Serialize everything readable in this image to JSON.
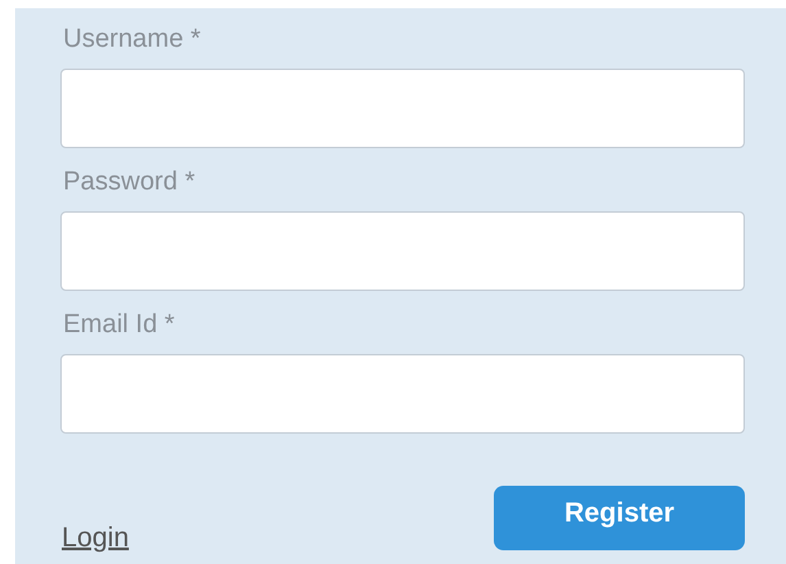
{
  "fields": [
    {
      "label": "Username *"
    },
    {
      "label": "Password *"
    },
    {
      "label": "Email Id *"
    }
  ],
  "login_link": "Login",
  "register_button": "Register"
}
